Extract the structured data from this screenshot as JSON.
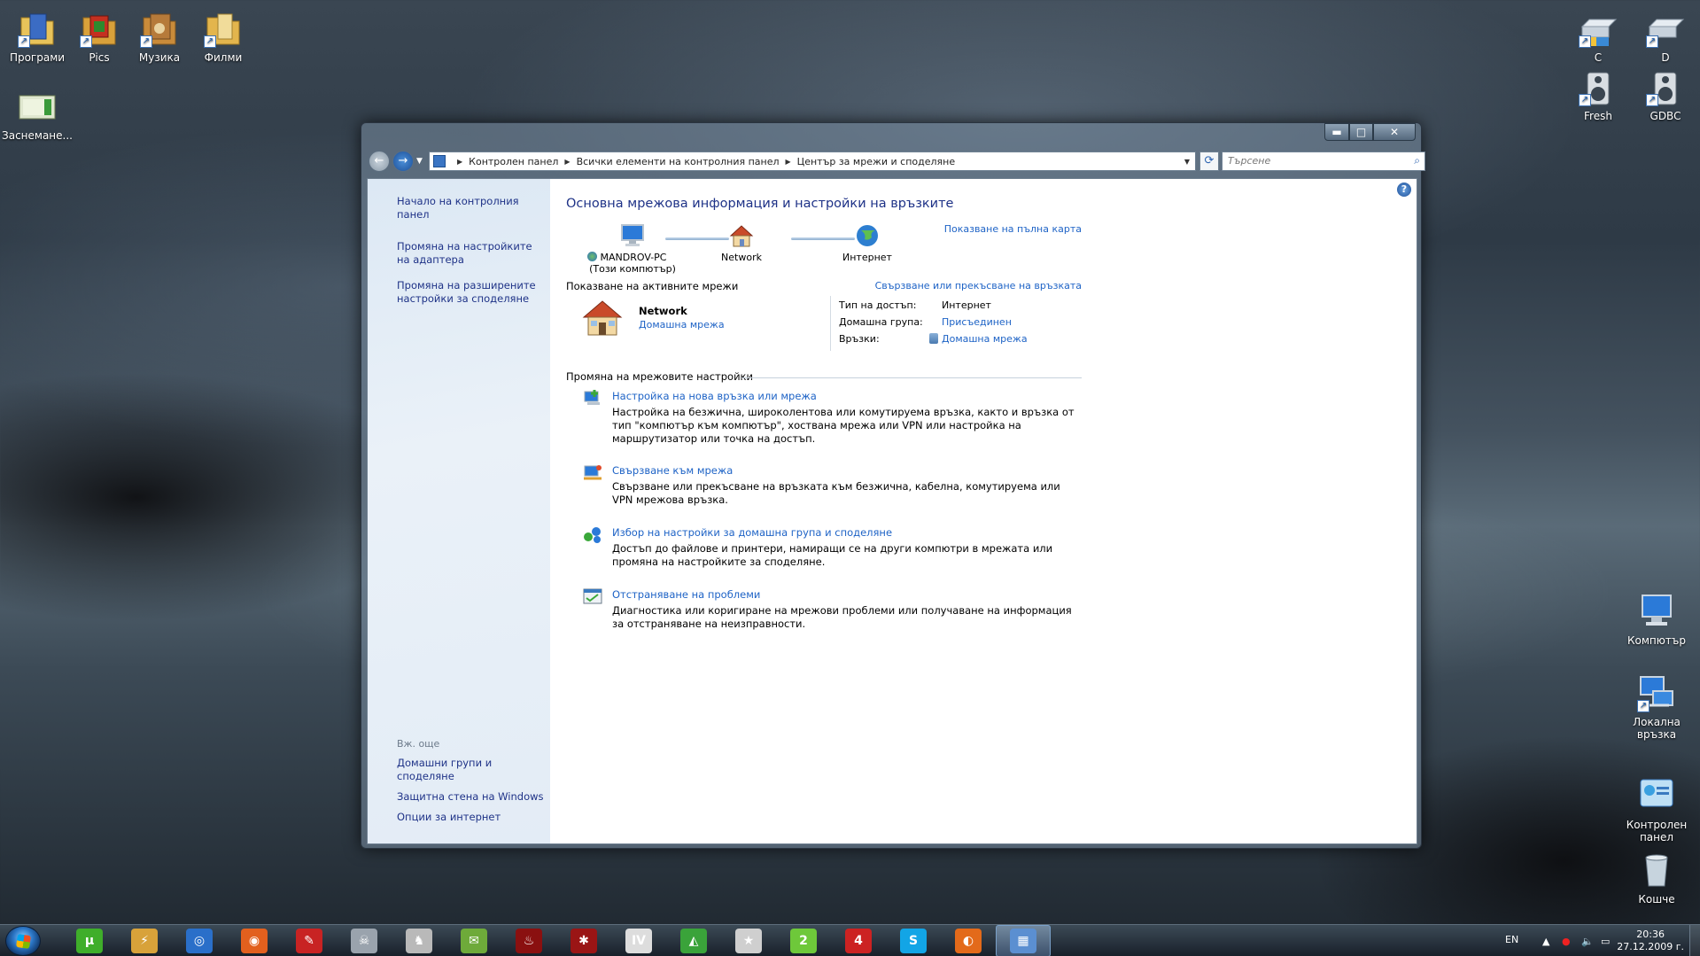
{
  "desktop": {
    "left_icons": [
      {
        "label": "Програми",
        "icon": "folder-icon",
        "color": "#e8c35a"
      },
      {
        "label": "Pics",
        "icon": "folder-icon",
        "color": "#d9a13a"
      },
      {
        "label": "Музика",
        "icon": "folder-icon",
        "color": "#c98b3a"
      },
      {
        "label": "Филми",
        "icon": "folder-icon",
        "color": "#e3b54d"
      },
      {
        "label": "Заснемане...",
        "icon": "film-icon",
        "color": "#dfe7cf"
      }
    ],
    "right_icons": [
      {
        "label": "C",
        "icon": "drive-icon"
      },
      {
        "label": "D",
        "icon": "drive-icon"
      },
      {
        "label": "Fresh",
        "icon": "speaker-icon"
      },
      {
        "label": "GDBC",
        "icon": "speaker-icon"
      },
      {
        "label": "Компютър",
        "icon": "computer-icon"
      },
      {
        "label": "Локална връзка",
        "icon": "network-computer-icon"
      },
      {
        "label": "Контролен панел",
        "icon": "control-panel-icon"
      },
      {
        "label": "Кошче",
        "icon": "recycle-bin-icon"
      }
    ]
  },
  "window": {
    "controls": {
      "minimize": "▬",
      "maximize": "□",
      "close": "✕"
    },
    "breadcrumbs": [
      "Контролен панел",
      "Всички елементи на контролния панел",
      "Център за мрежи и споделяне"
    ],
    "search_placeholder": "Търсене",
    "help": "?"
  },
  "sidebar": {
    "home": "Начало на контролния панел",
    "links": [
      "Промяна на настройките на адаптера",
      "Промяна на разширените настройки за споделяне"
    ],
    "see_also_label": "Вж. още",
    "see_also": [
      "Домашни групи и споделяне",
      "Защитна стена на Windows",
      "Опции за интернет"
    ]
  },
  "main": {
    "title": "Основна мрежова информация и настройки на връзките",
    "full_map_link": "Показване на пълна карта",
    "map": {
      "computer_name": "MANDROV-PC",
      "computer_sub": "(Този компютър)",
      "network": "Network",
      "internet": "Интернет"
    },
    "active_header": "Показване на активните мрежи",
    "connect_link": "Свързване или прекъсване на връзката",
    "active_network": {
      "name": "Network",
      "type": "Домашна мрежа",
      "props": [
        {
          "key": "Тип на достъп:",
          "value": "Интернет"
        },
        {
          "key": "Домашна група:",
          "value": "Присъединен"
        },
        {
          "key": "Връзки:",
          "value": "Домашна мрежа"
        }
      ]
    },
    "settings_header": "Промяна на мрежовите настройки",
    "tasks": [
      {
        "title": "Настройка на нова връзка или мрежа",
        "desc": "Настройка на безжична, широколентова или комутируема връзка, както и връзка от тип \"компютър към компютър\", хоствана мрежа или VPN или настройка на маршрутизатор или точка на достъп."
      },
      {
        "title": "Свързване към мрежа",
        "desc": "Свързване или прекъсване на връзката към безжична, кабелна, комутируема или VPN мрежова връзка."
      },
      {
        "title": "Избор на настройки за домашна група и споделяне",
        "desc": "Достъп до файлове и принтери, намиращи се на други компютри в мрежата или промяна на настройките за споделяне."
      },
      {
        "title": "Отстраняване на проблеми",
        "desc": "Диагностика или коригиране на мрежови проблеми или получаване на информация за отстраняване на неизправности."
      }
    ]
  },
  "taskbar": {
    "items": [
      {
        "icon": "utorrent-icon",
        "color": "#3fae2a",
        "glyph": "µ"
      },
      {
        "icon": "winamp-icon",
        "color": "#d8a23a",
        "glyph": "⚡"
      },
      {
        "icon": "google-earth-icon",
        "color": "#2a6fc9",
        "glyph": "◎"
      },
      {
        "icon": "orange-app-icon",
        "color": "#e2601e",
        "glyph": "◉"
      },
      {
        "icon": "red-app-icon",
        "color": "#c82323",
        "glyph": "✎"
      },
      {
        "icon": "game-soldier-icon",
        "color": "#9aa3ad",
        "glyph": "☠"
      },
      {
        "icon": "game-assassin-icon",
        "color": "#b9b9b9",
        "glyph": "♞"
      },
      {
        "icon": "chat-icon",
        "color": "#6eaa3a",
        "glyph": "✉"
      },
      {
        "icon": "game-red-icon",
        "color": "#8a1010",
        "glyph": "♨"
      },
      {
        "icon": "game-spider-icon",
        "color": "#9a1515",
        "glyph": "✱"
      },
      {
        "icon": "gta-iv-icon",
        "color": "#dddddd",
        "glyph": "IV"
      },
      {
        "icon": "game-green-icon",
        "color": "#3aa33a",
        "glyph": "◭"
      },
      {
        "icon": "game-star-icon",
        "color": "#cfcfcf",
        "glyph": "★"
      },
      {
        "icon": "game-2-icon",
        "color": "#6ec83a",
        "glyph": "2"
      },
      {
        "icon": "game-4-icon",
        "color": "#c22",
        "glyph": "4"
      },
      {
        "icon": "skype-icon",
        "color": "#12a5e6",
        "glyph": "S"
      },
      {
        "icon": "firefox-icon",
        "color": "#e36a1a",
        "glyph": "◐"
      },
      {
        "icon": "network-center-icon",
        "color": "#5b8fd1",
        "glyph": "▦"
      }
    ],
    "lang": "EN",
    "time": "20:36",
    "date": "27.12.2009 г."
  }
}
